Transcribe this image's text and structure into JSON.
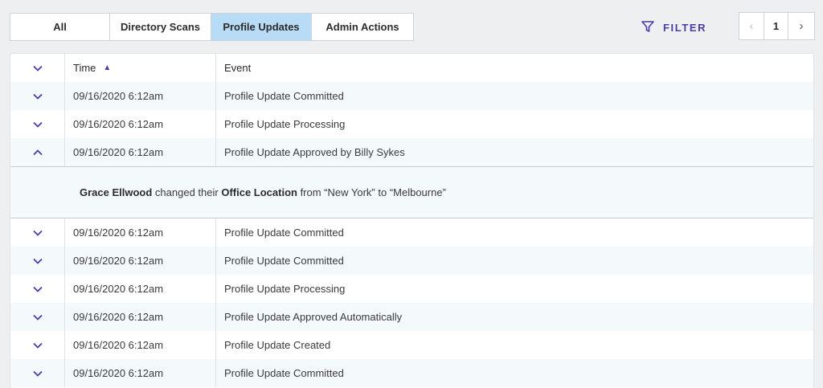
{
  "tabs": [
    {
      "label": "All"
    },
    {
      "label": "Directory Scans"
    },
    {
      "label": "Profile Updates"
    },
    {
      "label": "Admin Actions"
    }
  ],
  "filter": {
    "label": "FILTER",
    "icon": "filter-icon"
  },
  "pagination": {
    "prev": "‹",
    "page": "1",
    "next": "›"
  },
  "table": {
    "headers": {
      "time": "Time",
      "event": "Event"
    },
    "rows": [
      {
        "time": "09/16/2020 6:12am",
        "event": "Profile Update Committed"
      },
      {
        "time": "09/16/2020 6:12am",
        "event": "Profile Update Processing"
      },
      {
        "time": "09/16/2020 6:12am",
        "event": "Profile Update Approved by Billy Sykes"
      },
      {
        "time": "09/16/2020 6:12am",
        "event": "Profile Update Committed"
      },
      {
        "time": "09/16/2020 6:12am",
        "event": "Profile Update Committed"
      },
      {
        "time": "09/16/2020 6:12am",
        "event": "Profile Update Processing"
      },
      {
        "time": "09/16/2020 6:12am",
        "event": "Profile Update Approved Automatically"
      },
      {
        "time": "09/16/2020 6:12am",
        "event": "Profile Update Created"
      },
      {
        "time": "09/16/2020 6:12am",
        "event": "Profile Update Committed"
      }
    ],
    "detail": {
      "user": "Grace Ellwood",
      "text1": " changed their ",
      "field": "Office Location",
      "text2": " from “New York” to “Melbourne”"
    }
  },
  "colors": {
    "accent": "#4b3aa8",
    "active_tab": "#b9dcf6",
    "row_alt": "#f4f9fc"
  }
}
